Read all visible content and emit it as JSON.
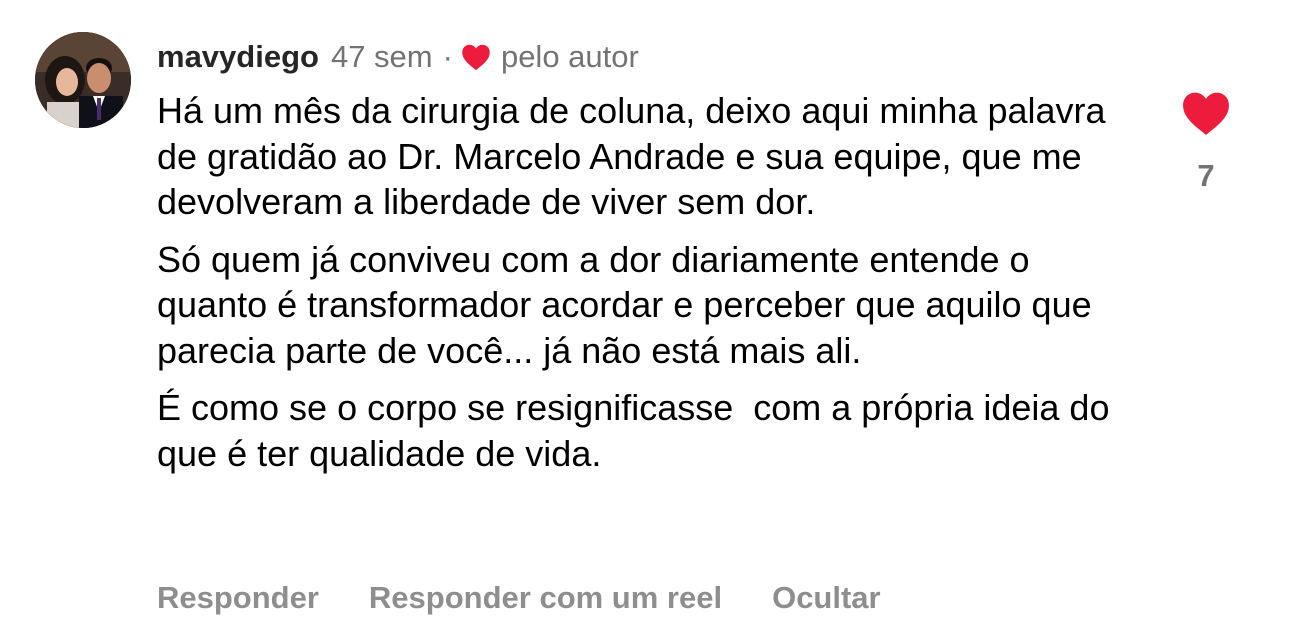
{
  "comment": {
    "username": "mavydiego",
    "time": "47 sem",
    "separator": "·",
    "author_badge": "pelo autor",
    "paragraphs": [
      "Há um mês da cirurgia de coluna, deixo aqui minha palavra de gratidão ao Dr. Marcelo Andrade e sua equipe, que me devolveram a liberdade de viver sem dor.",
      "Só quem já conviveu com a dor diariamente entende o quanto é transformador acordar e perceber que aquilo que parecia parte de você... já não está mais ali.",
      "É como se o corpo se resignificasse  com a própria ideia do que é ter qualidade de vida."
    ],
    "like_count": "7",
    "like_icon": "heart-filled-icon",
    "author_heart_icon": "heart-filled-icon",
    "heart_color": "#ed1c3c"
  },
  "actions": {
    "reply": "Responder",
    "reply_reel": "Responder com um reel",
    "hide": "Ocultar"
  }
}
